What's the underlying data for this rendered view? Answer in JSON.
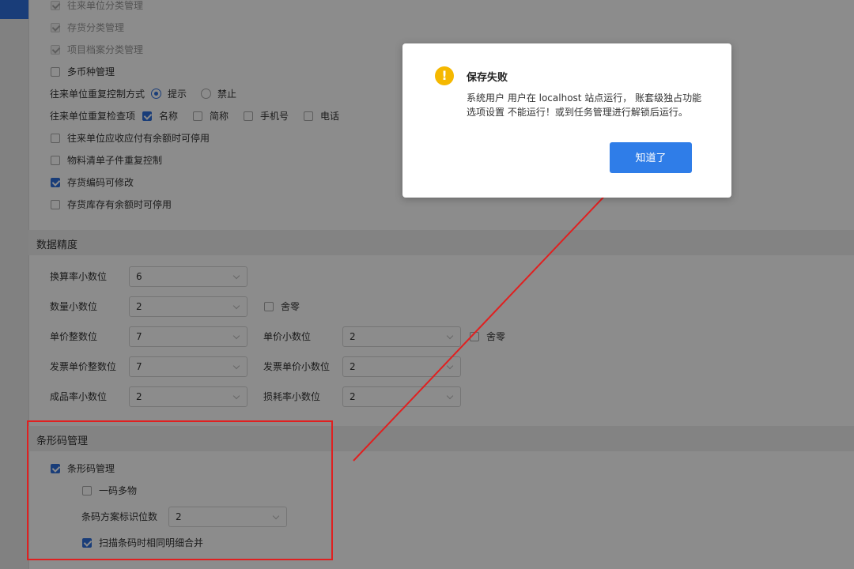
{
  "general": {
    "partner_class": "往来单位分类管理",
    "inventory_class": "存货分类管理",
    "project_class": "项目档案分类管理",
    "multi_currency": "多币种管理",
    "dup_control_label": "往来单位重复控制方式",
    "dup_prompt": "提示",
    "dup_forbid": "禁止",
    "dup_check_label": "往来单位重复检查项",
    "check_name": "名称",
    "check_abbr": "简称",
    "check_mobile": "手机号",
    "check_phone": "电话",
    "partner_disable": "往来单位应收应付有余额时可停用",
    "bom_dup": "物料清单子件重复控制",
    "inv_code_edit": "存货编码可修改",
    "inv_stock_disable": "存货库存有余额时可停用"
  },
  "precision": {
    "section_title": "数据精度",
    "conv_rate_label": "换算率小数位",
    "conv_rate_value": "6",
    "qty_label": "数量小数位",
    "qty_value": "2",
    "qty_round": "舍零",
    "price_int_label": "单价整数位",
    "price_int_value": "7",
    "price_dec_label": "单价小数位",
    "price_dec_value": "2",
    "price_round": "舍零",
    "inv_price_int_label": "发票单价整数位",
    "inv_price_int_value": "7",
    "inv_price_dec_label": "发票单价小数位",
    "inv_price_dec_value": "2",
    "yield_label": "成品率小数位",
    "yield_value": "2",
    "loss_label": "损耗率小数位",
    "loss_value": "2"
  },
  "barcode": {
    "section_title": "条形码管理",
    "manage": "条形码管理",
    "one_code_multi": "一码多物",
    "scheme_label": "条码方案标识位数",
    "scheme_value": "2",
    "merge_detail": "扫描条码时相同明细合并"
  },
  "dialog": {
    "title": "保存失败",
    "message": "系统用户 用户在 localhost 站点运行， 账套级独占功能选项设置 不能运行！或到任务管理进行解锁后运行。",
    "ok": "知道了",
    "icon": "warning-icon",
    "icon_glyph": "!"
  },
  "colors": {
    "accent": "#2f6fdc",
    "button": "#2f7de8",
    "warning": "#f5b800",
    "annotation": "#e02020"
  }
}
